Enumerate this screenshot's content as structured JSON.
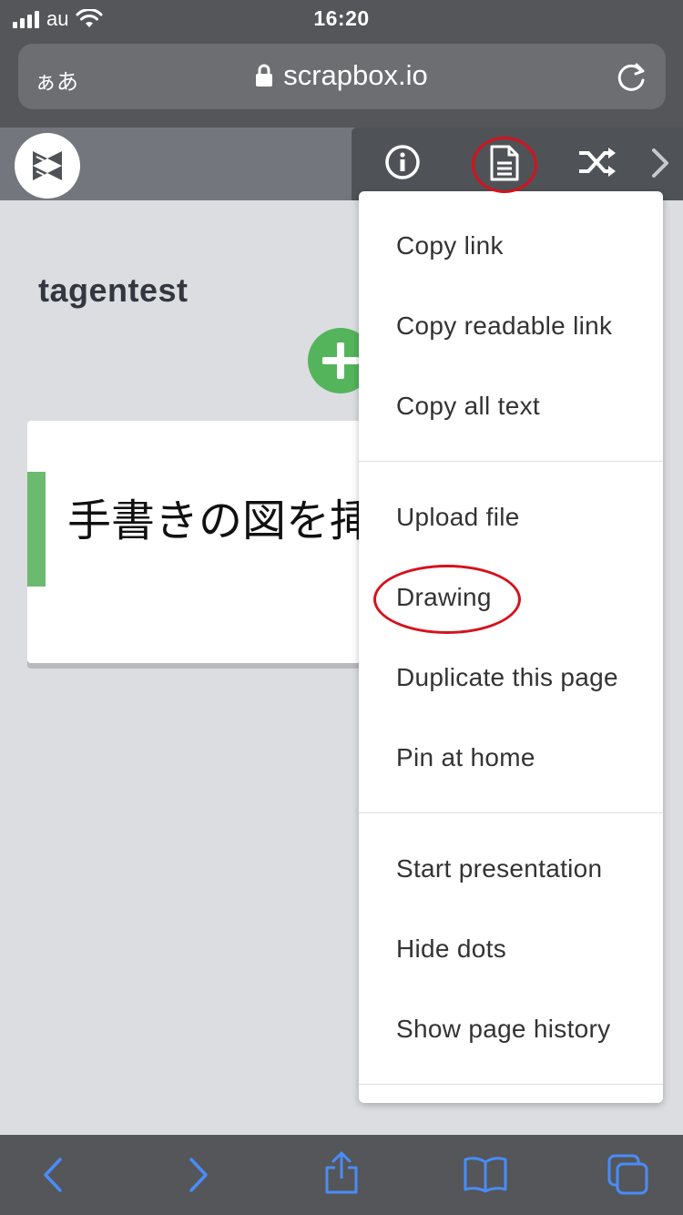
{
  "status_bar": {
    "carrier": "au",
    "time": "16:20"
  },
  "browser": {
    "aa_label": "ぁあ",
    "url": "scrapbox.io"
  },
  "page": {
    "title": "tagentest",
    "card_text": "手書きの図を挿"
  },
  "toolbar": {
    "icons": [
      "info-icon",
      "page-menu-icon",
      "random-jump-icon",
      "chevron-right-icon"
    ]
  },
  "menu": {
    "items": [
      "Copy link",
      "Copy readable link",
      "Copy all text",
      "Upload file",
      "Drawing",
      "Duplicate this page",
      "Pin at home",
      "Start presentation",
      "Hide dots",
      "Show page history"
    ]
  },
  "colors": {
    "accent_green": "#54b45b",
    "annotation_red": "#d5121c",
    "ios_link_blue": "#4a8cf7"
  }
}
